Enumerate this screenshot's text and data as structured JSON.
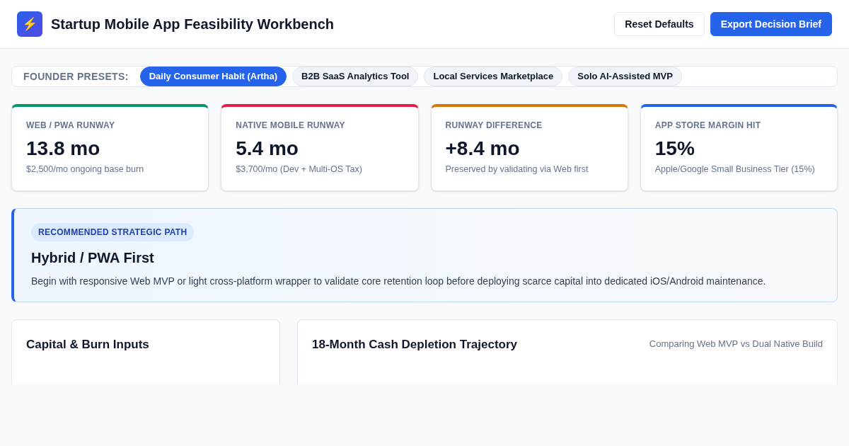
{
  "header": {
    "logo_glyph": "⚡",
    "title": "Startup Mobile App Feasibility Workbench",
    "buttons": [
      {
        "label": "Reset Defaults",
        "kind": "secondary"
      },
      {
        "label": "Export Decision Brief",
        "kind": "primary"
      }
    ]
  },
  "presets": {
    "label": "FOUNDER PRESETS:",
    "items": [
      {
        "label": "Daily Consumer Habit (Artha)",
        "selected": true
      },
      {
        "label": "B2B SaaS Analytics Tool",
        "selected": false
      },
      {
        "label": "Local Services Marketplace",
        "selected": false
      },
      {
        "label": "Solo AI-Assisted MVP",
        "selected": false
      }
    ]
  },
  "stats": [
    {
      "label": "WEB / PWA RUNWAY",
      "value": "13.8 mo",
      "note": "$2,500/mo ongoing base burn",
      "color": "#059669"
    },
    {
      "label": "NATIVE MOBILE RUNWAY",
      "value": "5.4 mo",
      "note": "$3,700/mo (Dev + Multi-OS Tax)",
      "color": "#e11d48"
    },
    {
      "label": "RUNWAY DIFFERENCE",
      "value": "+8.4 mo",
      "note": "Preserved by validating via Web first",
      "color": "#d97706"
    },
    {
      "label": "APP STORE MARGIN HIT",
      "value": "15%",
      "note": "Apple/Google Small Business Tier (15%)",
      "color": "#2563eb"
    }
  ],
  "recommendation": {
    "badge": "RECOMMENDED STRATEGIC PATH",
    "title": "Hybrid / PWA First",
    "text": "Begin with responsive Web MVP or light cross-platform wrapper to validate core retention loop before deploying scarce capital into dedicated iOS/Android maintenance."
  },
  "inputs_panel": {
    "title": "Capital & Burn Inputs"
  },
  "chart_panel": {
    "title": "18-Month Cash Depletion Trajectory",
    "subtitle": "Comparing Web MVP vs Dual Native Build"
  }
}
